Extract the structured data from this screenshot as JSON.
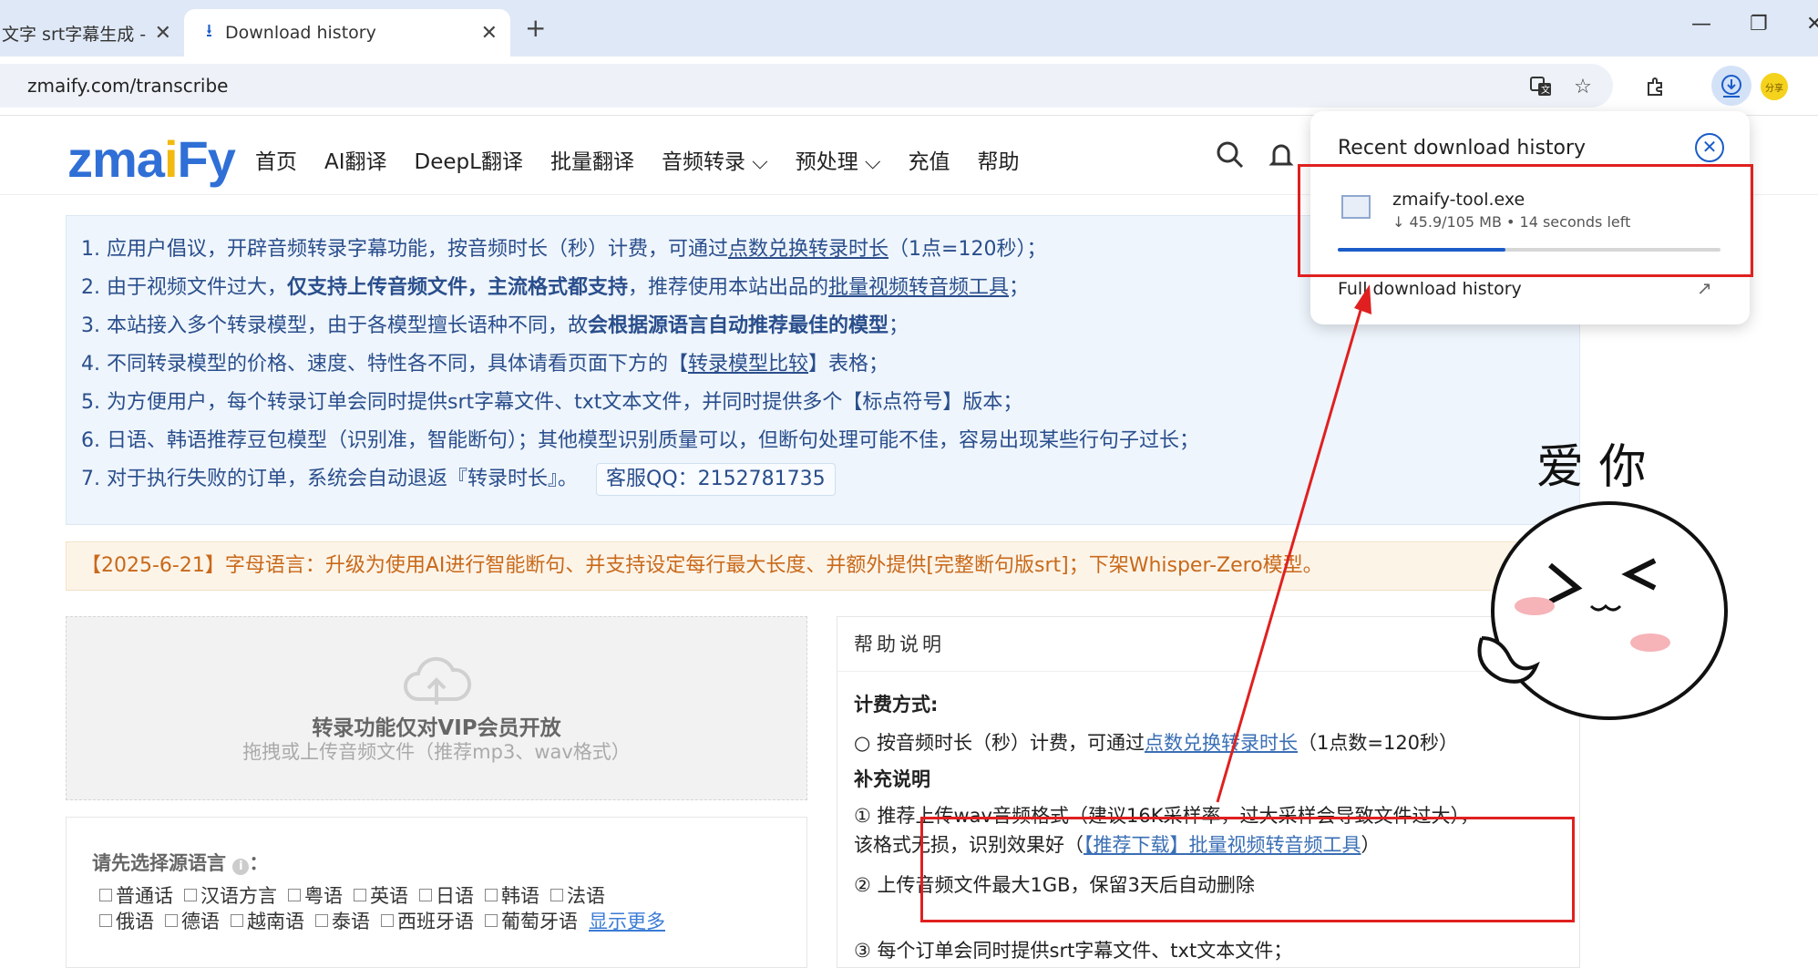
{
  "browser": {
    "tabs": [
      {
        "label": "文字 srt字幕生成 -",
        "close": "✕"
      },
      {
        "label": "Download history",
        "close": "✕"
      }
    ],
    "new_tab": "+",
    "window_controls": [
      "—",
      "❐",
      "✕"
    ],
    "url": "zmaify.com/transcribe",
    "profile_badge": "分享"
  },
  "site": {
    "logo": {
      "part1": "zma",
      "part2": "i",
      "part3": "Fy"
    },
    "nav": [
      "首页",
      "AI翻译",
      "DeepL翻译",
      "批量翻译",
      "音频转录 ⌵",
      "预处理 ⌵",
      "充值",
      "帮助"
    ]
  },
  "notice": {
    "l1a": "1. 应用户倡议，开辟音频转录字幕功能，按音频时长（秒）计费，可通过",
    "l1b": "点数兑换转录时长",
    "l1c": "（1点=120秒）；",
    "l2a": "2. 由于视频文件过大，",
    "l2b": "仅支持上传音频文件，主流格式都支持",
    "l2c": "，推荐使用本站出品的",
    "l2d": "批量视频转音频工具",
    "l2e": "；",
    "l3a": "3. 本站接入多个转录模型，由于各模型擅长语种不同，故",
    "l3b": "会根据源语言自动推荐最佳的模型",
    "l3c": "；",
    "l4a": "4. 不同转录模型的价格、速度、特性各不同，具体请看页面下方的【",
    "l4b": "转录模型比较",
    "l4c": "】表格；",
    "l5": "5. 为方便用户，每个转录订单会同时提供srt字幕文件、txt文本文件，并同时提供多个【标点符号】版本；",
    "l6": "6. 日语、韩语推荐豆包模型（识别准，智能断句）；其他模型识别质量可以，但断句处理可能不佳，容易出现某些行句子过长；",
    "l7": "7. 对于执行失败的订单，系统会自动退返『转录时长』。",
    "qq": "客服QQ：2152781735"
  },
  "announcement": "【2025-6-21】字母语言：升级为使用AI进行智能断句、并支持设定每行最大长度、并额外提供[完整断句版srt]；下架Whisper-Zero模型。",
  "upload": {
    "title": "转录功能仅对VIP会员开放",
    "hint": "拖拽或上传音频文件（推荐mp3、wav格式）"
  },
  "language": {
    "label": "请先选择源语言",
    "colon": "：",
    "row1": [
      "普通话",
      "汉语方言",
      "粤语",
      "英语",
      "日语",
      "韩语",
      "法语"
    ],
    "row2": [
      "俄语",
      "德语",
      "越南语",
      "泰语",
      "西班牙语",
      "葡萄牙语"
    ],
    "more": "显示更多"
  },
  "help": {
    "header": "帮助说明",
    "billing_title": "计费方式:",
    "billing_a": "○ 按音频时长（秒）计费，可通过",
    "billing_link": "点数兑换转录时长",
    "billing_b": "（1点数=120秒）",
    "extra_title": "补充说明",
    "item1a": "① 推荐上传wav音频格式（建议16K采样率，过大采样会导致文件过大），",
    "item1b": "该格式无损，识别效果好（",
    "item1link": "【推荐下载】批量视频转音频工具",
    "item1c": "）",
    "item2": "② 上传音频文件最大1GB，保留3天后自动删除",
    "item3": "③ 每个订单会同时提供srt字幕文件、txt文本文件；"
  },
  "download_panel": {
    "title": "Recent download history",
    "file_name": "zmaify-tool.exe",
    "file_meta": "↓ 45.9/105 MB • 14 seconds left",
    "progress": 0.437,
    "full_history": "Full download history"
  },
  "sticker": {
    "text": "爱 你"
  },
  "colors": {
    "accent": "#1a5cc8",
    "annotation": "#e02020",
    "logo_blue": "#2f6fd6",
    "logo_yellow": "#f2b90f"
  }
}
